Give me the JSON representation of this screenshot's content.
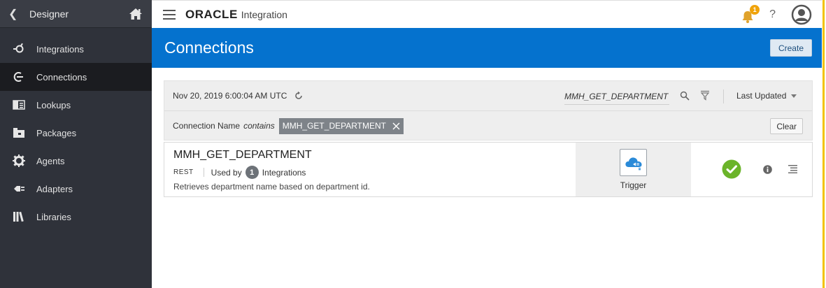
{
  "sidebar": {
    "title": "Designer",
    "items": [
      {
        "label": "Integrations",
        "icon": "integrations-icon",
        "active": false
      },
      {
        "label": "Connections",
        "icon": "connections-icon",
        "active": true
      },
      {
        "label": "Lookups",
        "icon": "lookups-icon",
        "active": false
      },
      {
        "label": "Packages",
        "icon": "packages-icon",
        "active": false
      },
      {
        "label": "Agents",
        "icon": "agents-icon",
        "active": false
      },
      {
        "label": "Adapters",
        "icon": "adapters-icon",
        "active": false
      },
      {
        "label": "Libraries",
        "icon": "libraries-icon",
        "active": false
      }
    ]
  },
  "topbar": {
    "brand": "ORACLE",
    "product": "Integration",
    "notification_count": "1",
    "help_label": "?"
  },
  "header": {
    "title": "Connections",
    "create_label": "Create"
  },
  "filters": {
    "last_refreshed": "Nov 20, 2019 6:00:04 AM UTC",
    "search_value": "MMH_GET_DEPARTMENT",
    "sort_label": "Last Updated",
    "condition_field": "Connection Name",
    "condition_operator": "contains",
    "condition_value": "MMH_GET_DEPARTMENT",
    "clear_label": "Clear"
  },
  "results": [
    {
      "name": "MMH_GET_DEPARTMENT",
      "type": "REST",
      "used_by_prefix": "Used by",
      "used_by_count": "1",
      "used_by_suffix": "Integrations",
      "description": "Retrieves department name based on department id.",
      "role": "Trigger",
      "status": "configured"
    }
  ],
  "colors": {
    "accent": "#0572ce",
    "sidebar_bg": "#2f323a",
    "status_ok": "#6bb42a",
    "notification": "#f0a30a",
    "edge_highlight": "#f2c300"
  }
}
